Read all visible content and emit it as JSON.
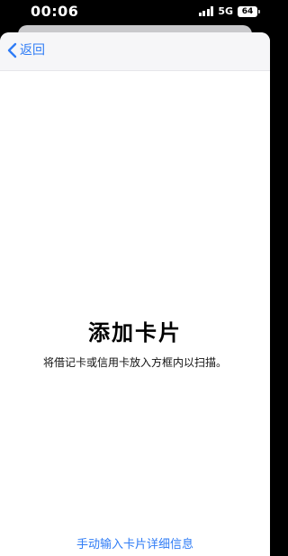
{
  "status_bar": {
    "time": "00:06",
    "network": "5G",
    "battery": "64"
  },
  "nav": {
    "back_label": "返回"
  },
  "main": {
    "title": "添加卡片",
    "instruction": "将借记卡或信用卡放入方框内以扫描。",
    "manual_entry_link": "手动输入卡片详细信息"
  },
  "colors": {
    "accent": "#2f7cf6",
    "background": "#ffffff",
    "status_bar": "#000000"
  },
  "icons": {
    "back": "chevron-left-icon",
    "signal": "cellular-signal-icon",
    "battery": "battery-icon"
  }
}
